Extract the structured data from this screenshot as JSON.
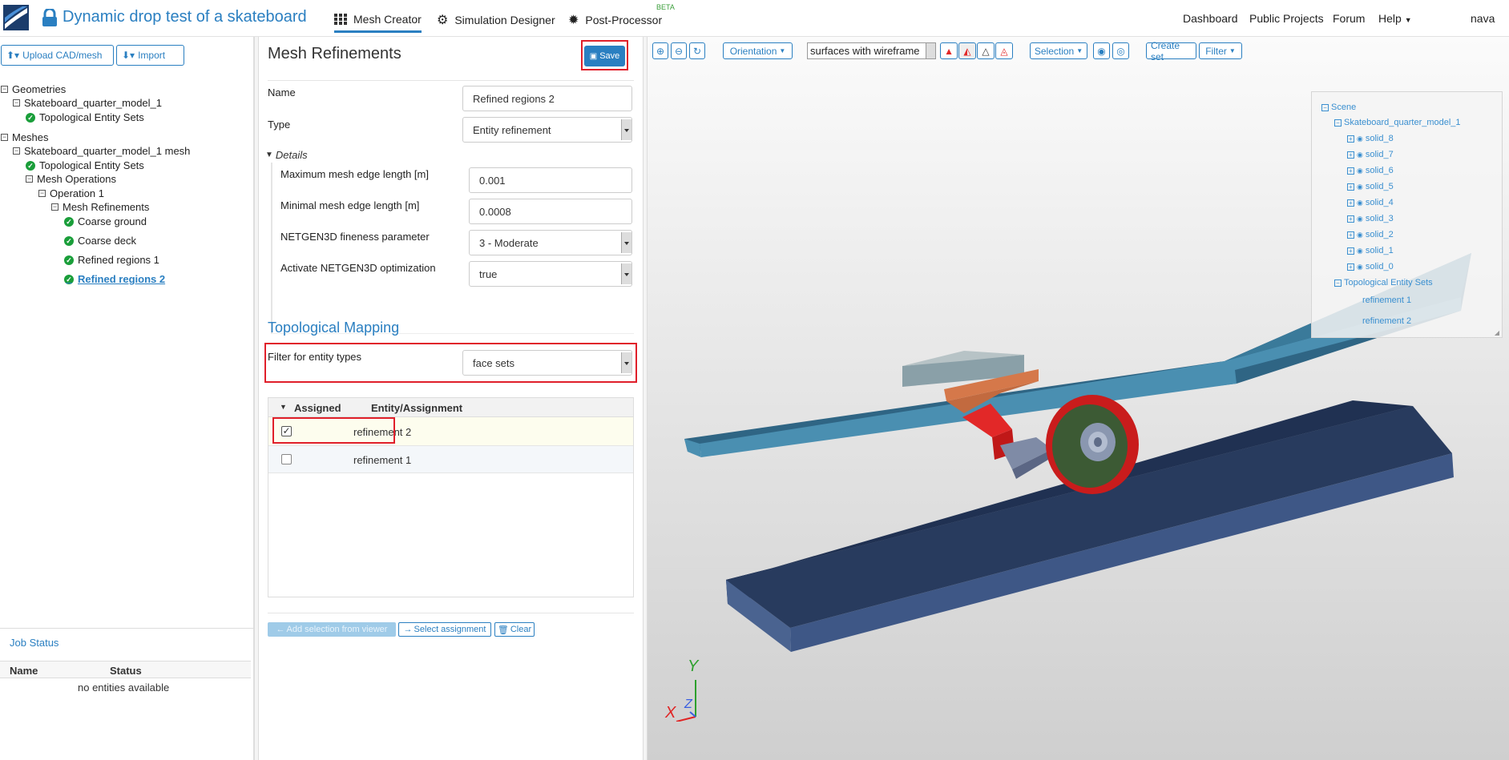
{
  "header": {
    "project_title": "Dynamic drop test of a skateboard",
    "tabs": [
      {
        "label": "Mesh Creator"
      },
      {
        "label": "Simulation Designer"
      },
      {
        "label": "Post-Processor"
      }
    ],
    "beta_badge": "BETA",
    "links": [
      "Dashboard",
      "Public Projects",
      "Forum",
      "Help"
    ],
    "user": "nava"
  },
  "left": {
    "upload_btn": "Upload CAD/mesh",
    "import_btn": "Import",
    "tree": [
      {
        "label": "Geometries"
      },
      {
        "label": "Skateboard_quarter_model_1"
      },
      {
        "label": "Topological Entity Sets"
      },
      {
        "label": "Meshes"
      },
      {
        "label": "Skateboard_quarter_model_1 mesh"
      },
      {
        "label": "Topological Entity Sets"
      },
      {
        "label": "Mesh Operations"
      },
      {
        "label": "Operation 1"
      },
      {
        "label": "Mesh Refinements"
      },
      {
        "label": "Coarse ground"
      },
      {
        "label": "Coarse deck"
      },
      {
        "label": "Refined regions 1"
      },
      {
        "label": "Refined regions 2"
      }
    ],
    "job_status": {
      "title": "Job Status",
      "col_name": "Name",
      "col_status": "Status",
      "empty": "no entities available"
    }
  },
  "form": {
    "title": "Mesh Refinements",
    "save": "Save",
    "name_label": "Name",
    "name_value": "Refined regions 2",
    "type_label": "Type",
    "type_value": "Entity refinement",
    "details": "Details",
    "max_edge_label": "Maximum mesh edge length [m]",
    "max_edge_value": "0.001",
    "min_edge_label": "Minimal mesh edge length [m]",
    "min_edge_value": "0.0008",
    "fineness_label": "NETGEN3D fineness parameter",
    "fineness_value": "3 - Moderate",
    "optim_label": "Activate NETGEN3D optimization",
    "optim_value": "true",
    "topo_title": "Topological Mapping",
    "filter_label": "Filter for entity types",
    "filter_value": "face sets",
    "col_assigned": "Assigned",
    "col_entity": "Entity/Assignment",
    "rows": [
      {
        "label": "refinement 2",
        "checked": true
      },
      {
        "label": "refinement 1",
        "checked": false
      }
    ],
    "add_selection": "Add selection from viewer",
    "select_assignment": "Select assignment",
    "clear": "Clear"
  },
  "viewer": {
    "orientation": "Orientation",
    "render_mode": "surfaces with wireframe",
    "selection": "Selection",
    "create_set": "Create set",
    "filter": "Filter",
    "axis_y": "Y",
    "axis_x": "X",
    "axis_z": "Z",
    "scene_root": "Scene",
    "model": "Skateboard_quarter_model_1",
    "solids": [
      "solid_8",
      "solid_7",
      "solid_6",
      "solid_5",
      "solid_4",
      "solid_3",
      "solid_2",
      "solid_1",
      "solid_0"
    ],
    "topo_sets": "Topological Entity Sets",
    "sets": [
      "refinement 1",
      "refinement 2"
    ]
  }
}
